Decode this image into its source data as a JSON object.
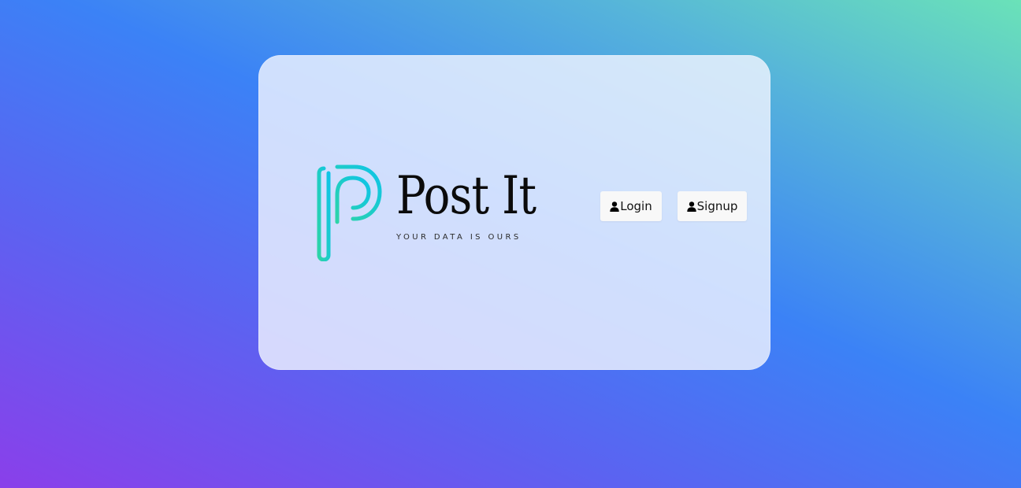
{
  "brand": {
    "name": "Post It",
    "tagline": "YOUR DATA IS OURS",
    "logo_icon": "p-logo-icon"
  },
  "auth": {
    "login_label": "Login",
    "signup_label": "Signup",
    "button_icon": "user-icon"
  },
  "colors": {
    "logo_gradient_start": "#22d3c5",
    "logo_gradient_end": "#10c0e6",
    "button_bg": "#f8f8f8"
  }
}
